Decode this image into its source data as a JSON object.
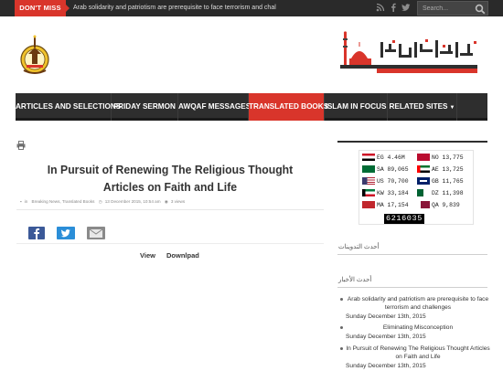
{
  "topbar": {
    "dont_miss_label": "DON'T MISS",
    "ticker_text": "Arab solidarity and patriotism are prerequisite to face terrorism and challenges",
    "search_placeholder": "Search...",
    "social_icons": [
      "rss-icon",
      "facebook-icon",
      "twitter-icon"
    ]
  },
  "header": {
    "logo_left_icon": "ministry-emblem",
    "logo_right_icon": "awqaf-arabic-logo"
  },
  "nav": {
    "items": [
      {
        "label": "ARTICLES AND SELECTIONS"
      },
      {
        "label": "FRIDAY SERMON"
      },
      {
        "label": "AWQAF MESSAGES"
      },
      {
        "label": "TRANSLATED BOOKS",
        "active": true
      },
      {
        "label": "ISLAM IN FOCUS"
      },
      {
        "label": "RELATED SITES",
        "has_dropdown": true
      }
    ]
  },
  "post": {
    "title": "In Pursuit of Renewing The Religious Thought Articles on Faith and Life",
    "meta": {
      "categories": "in ",
      "category_links": "Breaking News, Translated Books",
      "date": "13 December 2015, 10:54 am",
      "views": "3 views"
    },
    "share_icons": [
      "facebook-share-icon",
      "twitter-share-icon",
      "email-share-icon"
    ],
    "tabs": [
      "View",
      "Downlpad"
    ]
  },
  "sidebar": {
    "flags": [
      {
        "code": "EG",
        "count": "4.46M",
        "color_a": "#ce1126",
        "color_b": "#000000"
      },
      {
        "code": "NO",
        "count": "13,775",
        "color_a": "#ba0c2f",
        "color_b": "#00205b"
      },
      {
        "code": "SA",
        "count": "89,065",
        "color_a": "#006c35",
        "color_b": "#006c35"
      },
      {
        "code": "AE",
        "count": "13,725",
        "color_a": "#00732f",
        "color_b": "#ff0000"
      },
      {
        "code": "US",
        "count": "70,700",
        "color_a": "#3c3b6e",
        "color_b": "#b22234"
      },
      {
        "code": "GB",
        "count": "11,765",
        "color_a": "#012169",
        "color_b": "#c8102e"
      },
      {
        "code": "KW",
        "count": "33,184",
        "color_a": "#007a3d",
        "color_b": "#ce1126"
      },
      {
        "code": "DZ",
        "count": "11,398",
        "color_a": "#006233",
        "color_b": "#d21034"
      },
      {
        "code": "MA",
        "count": "17,154",
        "color_a": "#c1272d",
        "color_b": "#c1272d"
      },
      {
        "code": "QA",
        "count": "9,839",
        "color_a": "#8a1538",
        "color_b": "#8a1538"
      }
    ],
    "visitor_counter": "6216035",
    "latest_blogs_heading": "أحدث التدوينات",
    "latest_news_heading": "أحدث الأخبار",
    "recent_posts": [
      {
        "title": "Arab solidarity and patriotism are prerequisite to face terrorism and challenges",
        "date": "Sunday December 13th, 2015"
      },
      {
        "title": "Eliminating Misconception",
        "date": "Sunday December 13th, 2015"
      },
      {
        "title": "In Pursuit of Renewing The Religious Thought Articles on Faith and Life",
        "date": "Sunday December 13th, 2015"
      }
    ]
  }
}
